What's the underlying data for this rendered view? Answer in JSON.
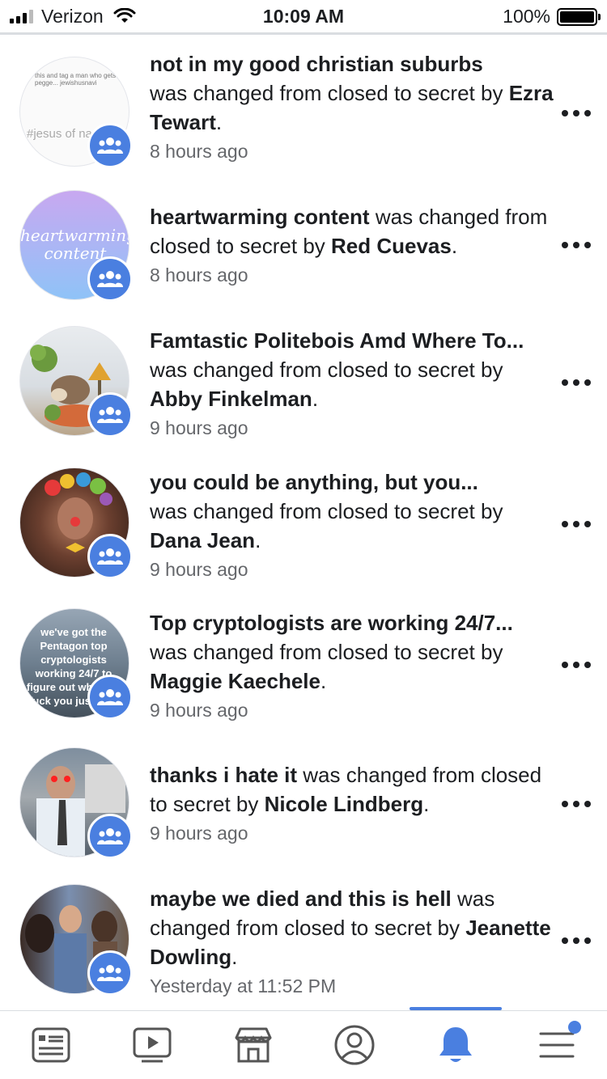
{
  "status_bar": {
    "carrier": "Verizon",
    "time": "10:09 AM",
    "battery": "100%",
    "battery_level": 1.0
  },
  "notifications": [
    {
      "group": "not in my good christian suburbs",
      "middle": "was changed from closed to secret by",
      "user": "Ezra Tewart",
      "end": ".",
      "time": "8 hours ago",
      "avatar_text_top": "this and tag a man who gets pegge... jewishusnavi",
      "avatar_text": "#jesus of nazareth"
    },
    {
      "group": "heartwarming content",
      "middle": "was changed from closed to secret by",
      "user": "Red Cuevas",
      "end": ".",
      "time": "8 hours ago",
      "avatar_text": "heartwarming content"
    },
    {
      "group": "Famtastic Politebois Amd Where To...",
      "middle": "was changed from closed to secret by",
      "user": "Abby Finkelman",
      "end": ".",
      "time": "9 hours ago"
    },
    {
      "group": "you could be anything, but you...",
      "middle": "was changed from closed to secret by",
      "user": "Dana Jean",
      "end": ".",
      "time": "9 hours ago"
    },
    {
      "group": "Top cryptologists are working 24/7...",
      "middle": "was changed from closed to secret by",
      "user": "Maggie Kaechele",
      "end": ".",
      "time": "9 hours ago",
      "avatar_text": "we've got the Pentagon top cryptologists working 24/7 to figure out what the fuck you just said"
    },
    {
      "group": "thanks i hate it",
      "middle": "was changed from closed to secret by",
      "user": "Nicole Lindberg",
      "end": ".",
      "time": "9 hours ago"
    },
    {
      "group": "maybe we died and this is hell",
      "middle": "was changed from closed to secret by",
      "user": "Jeanette Dowling",
      "end": ".",
      "time": "Yesterday at 11:52 PM"
    }
  ],
  "bottom_nav": {
    "items": [
      "news-feed-icon",
      "watch-icon",
      "marketplace-icon",
      "profile-icon",
      "notifications-bell-icon",
      "menu-icon"
    ],
    "active": "notifications-bell-icon",
    "accent": "#4a7fe0"
  },
  "colors": {
    "accent": "#4a7fe0",
    "text": "#1c1e21",
    "secondary_text": "#65676b"
  }
}
